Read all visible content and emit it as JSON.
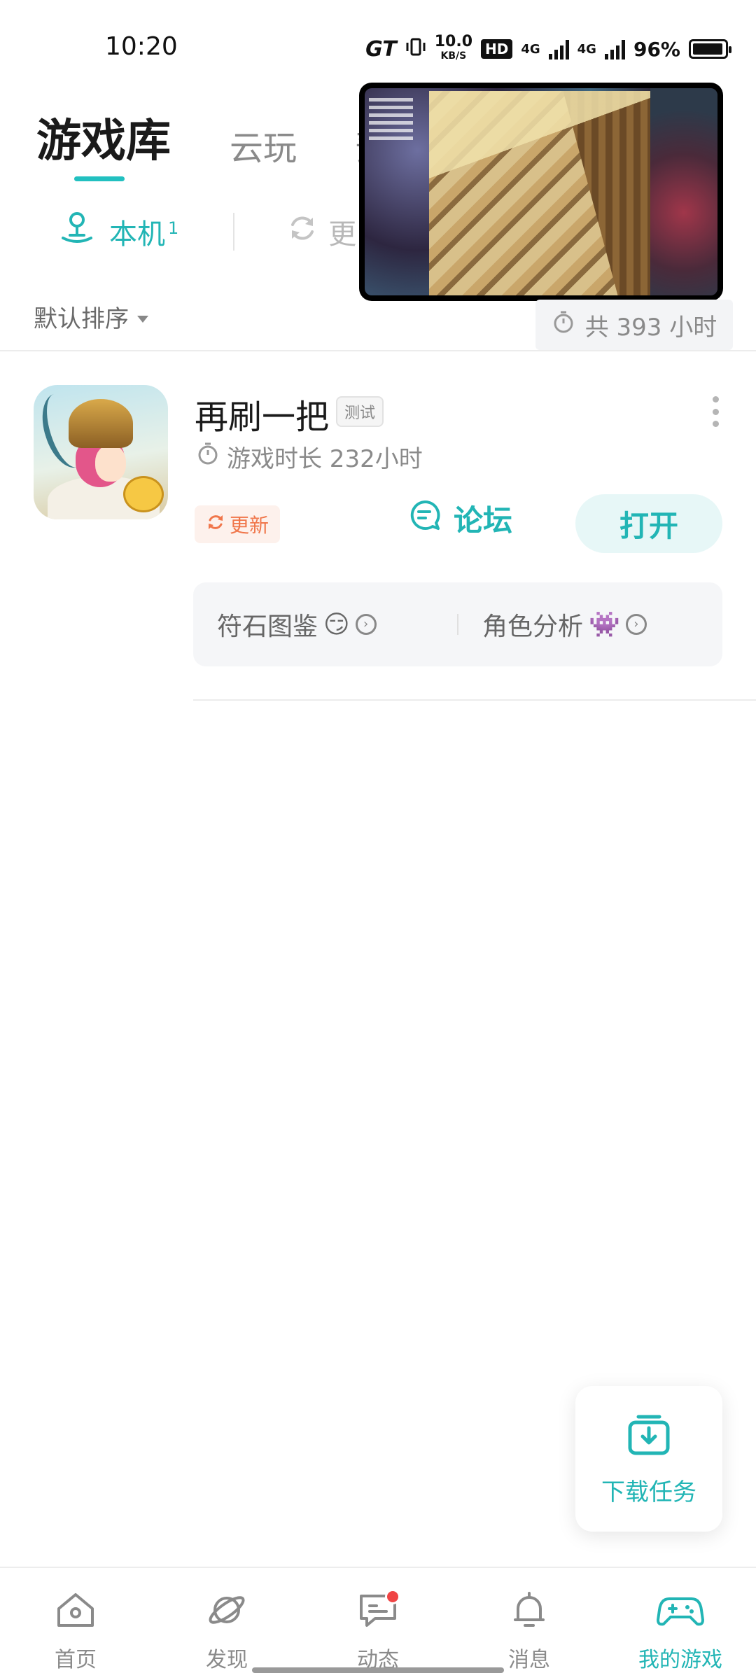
{
  "status_bar": {
    "time": "10:20",
    "gt_label": "GT",
    "net_speed": "10.0",
    "net_unit": "KB/S",
    "hd_label": "HD",
    "sim1": "4G",
    "sim2": "4G",
    "battery": "96%"
  },
  "top_tabs": [
    {
      "label": "游戏库",
      "active": true
    },
    {
      "label": "云玩",
      "active": false
    },
    {
      "label": "预",
      "active": false
    }
  ],
  "sub_tabs": {
    "local_label": "本机",
    "local_count": "1",
    "update_label": "更"
  },
  "sort": {
    "label": "默认排序",
    "total_time": "共 393 小时"
  },
  "game": {
    "title": "再刷一把",
    "tag": "测试",
    "play_time": "游戏时长 232小时",
    "update_label": "更新",
    "forum_label": "论坛",
    "open_label": "打开",
    "quick_links": [
      {
        "label": "符石图鉴",
        "emoji": "😏"
      },
      {
        "label": "角色分析",
        "emoji": "👾"
      }
    ]
  },
  "download_task": {
    "label": "下载任务"
  },
  "bottom_nav": [
    {
      "label": "首页",
      "icon": "home-icon",
      "active": false
    },
    {
      "label": "发现",
      "icon": "planet-icon",
      "active": false
    },
    {
      "label": "动态",
      "icon": "chat-icon",
      "active": false,
      "badge": true
    },
    {
      "label": "消息",
      "icon": "bell-icon",
      "active": false
    },
    {
      "label": "我的游戏",
      "icon": "gamepad-icon",
      "active": true
    }
  ],
  "colors": {
    "accent": "#22b5b5",
    "update_orange": "#f0764a",
    "badge_red": "#f04545"
  }
}
